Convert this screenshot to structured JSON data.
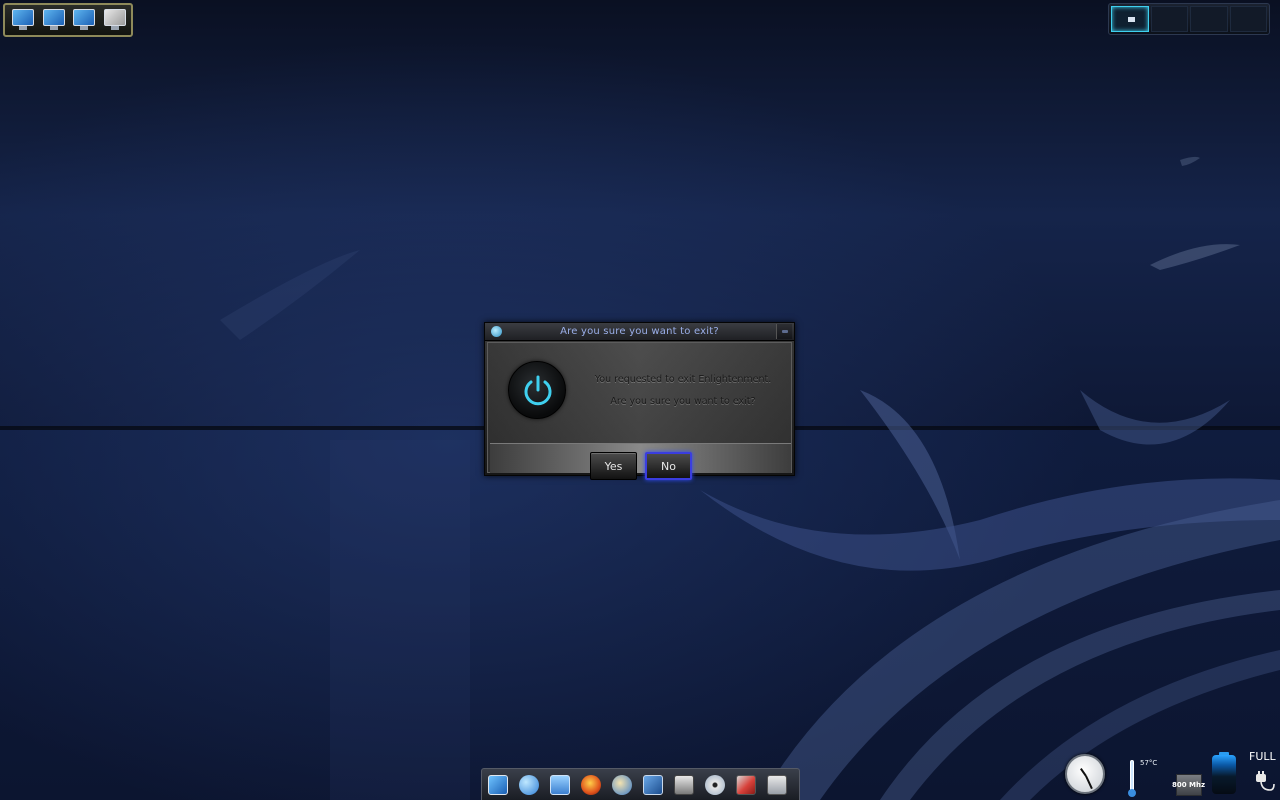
{
  "dialog": {
    "title": "Are you sure you want to exit?",
    "message_line1": "You requested to exit Enlightenment.",
    "message_line2": "Are you sure you want to exit?",
    "yes_label": "Yes",
    "no_label": "No",
    "default_button": "No",
    "icon": "power-icon"
  },
  "shelf_top_left": {
    "items": [
      "computer-icon",
      "computer-icon",
      "computer-icon",
      "home-computer-icon"
    ]
  },
  "pager": {
    "desks": 4,
    "active_desk": 1
  },
  "dock": {
    "items": [
      "computer-icon",
      "network-globe-icon",
      "file-manager-icon",
      "firefox-icon",
      "mail-icon",
      "image-editor-icon",
      "screenshot-icon",
      "disc-burner-icon",
      "settings-icon",
      "installer-icon"
    ]
  },
  "gadgets": {
    "temperature": "57°C",
    "cpu_freq": "800 Mhz",
    "battery_status": "FULL"
  },
  "colors": {
    "accent": "#3fd0ef",
    "dialog_title": "#9aaee8",
    "default_button_focus": "#3a3de0"
  }
}
